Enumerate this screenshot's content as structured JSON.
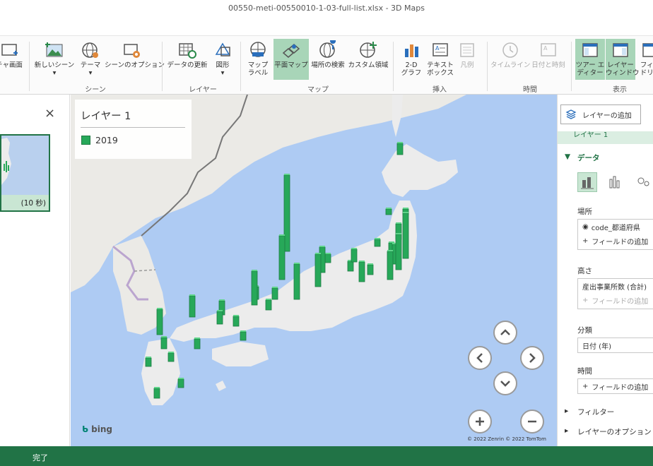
{
  "window": {
    "title": "00550-meti-00550010-1-03-full-list.xlsx - 3D Maps"
  },
  "ribbon": {
    "buttons": [
      {
        "label": "チャ画面"
      },
      {
        "label": "新しいシーン"
      },
      {
        "label": "テーマ"
      },
      {
        "label": "シーンのオプション"
      },
      {
        "label": "データの更新"
      },
      {
        "label": "図形"
      },
      {
        "label": "マップ\nラベル"
      },
      {
        "label": "平面マップ"
      },
      {
        "label": "場所の検索"
      },
      {
        "label": "カスタム領域"
      },
      {
        "label": "2-D\nグラフ"
      },
      {
        "label": "テキスト\nボックス"
      },
      {
        "label": "凡例"
      },
      {
        "label": "タイムライン"
      },
      {
        "label": "日付と時刻"
      },
      {
        "label": "ツアー エ\nディター"
      },
      {
        "label": "レイヤー\nウィンドウ"
      },
      {
        "label": "フィー\nドリス"
      }
    ],
    "groups": [
      "シーン",
      "レイヤー",
      "マップ",
      "挿入",
      "時間",
      "表示"
    ]
  },
  "left_panel": {
    "close": "×",
    "thumb_duration": "(10 秒)"
  },
  "legend": {
    "title": "レイヤー 1",
    "items": [
      {
        "name": "2019",
        "color": "#27a859"
      }
    ]
  },
  "map": {
    "provider": "bing",
    "copyright": "© 2022 Zenrin  © 2022 TomTom",
    "bar_color": "#27a859"
  },
  "right_panel": {
    "add_layer": "レイヤーの追加",
    "layer_name": "レイヤー 1",
    "data_section": "データ",
    "location_label": "場所",
    "location_field": "code_都道府県",
    "add_field": "フィールドの追加",
    "height_label": "高さ",
    "height_field": "産出事業所数 (合計)",
    "category_label": "分類",
    "category_value": "日付 (年)",
    "time_label": "時間",
    "filter": "フィルター",
    "layer_options": "レイヤーのオプション"
  },
  "status": {
    "text": "完了"
  }
}
